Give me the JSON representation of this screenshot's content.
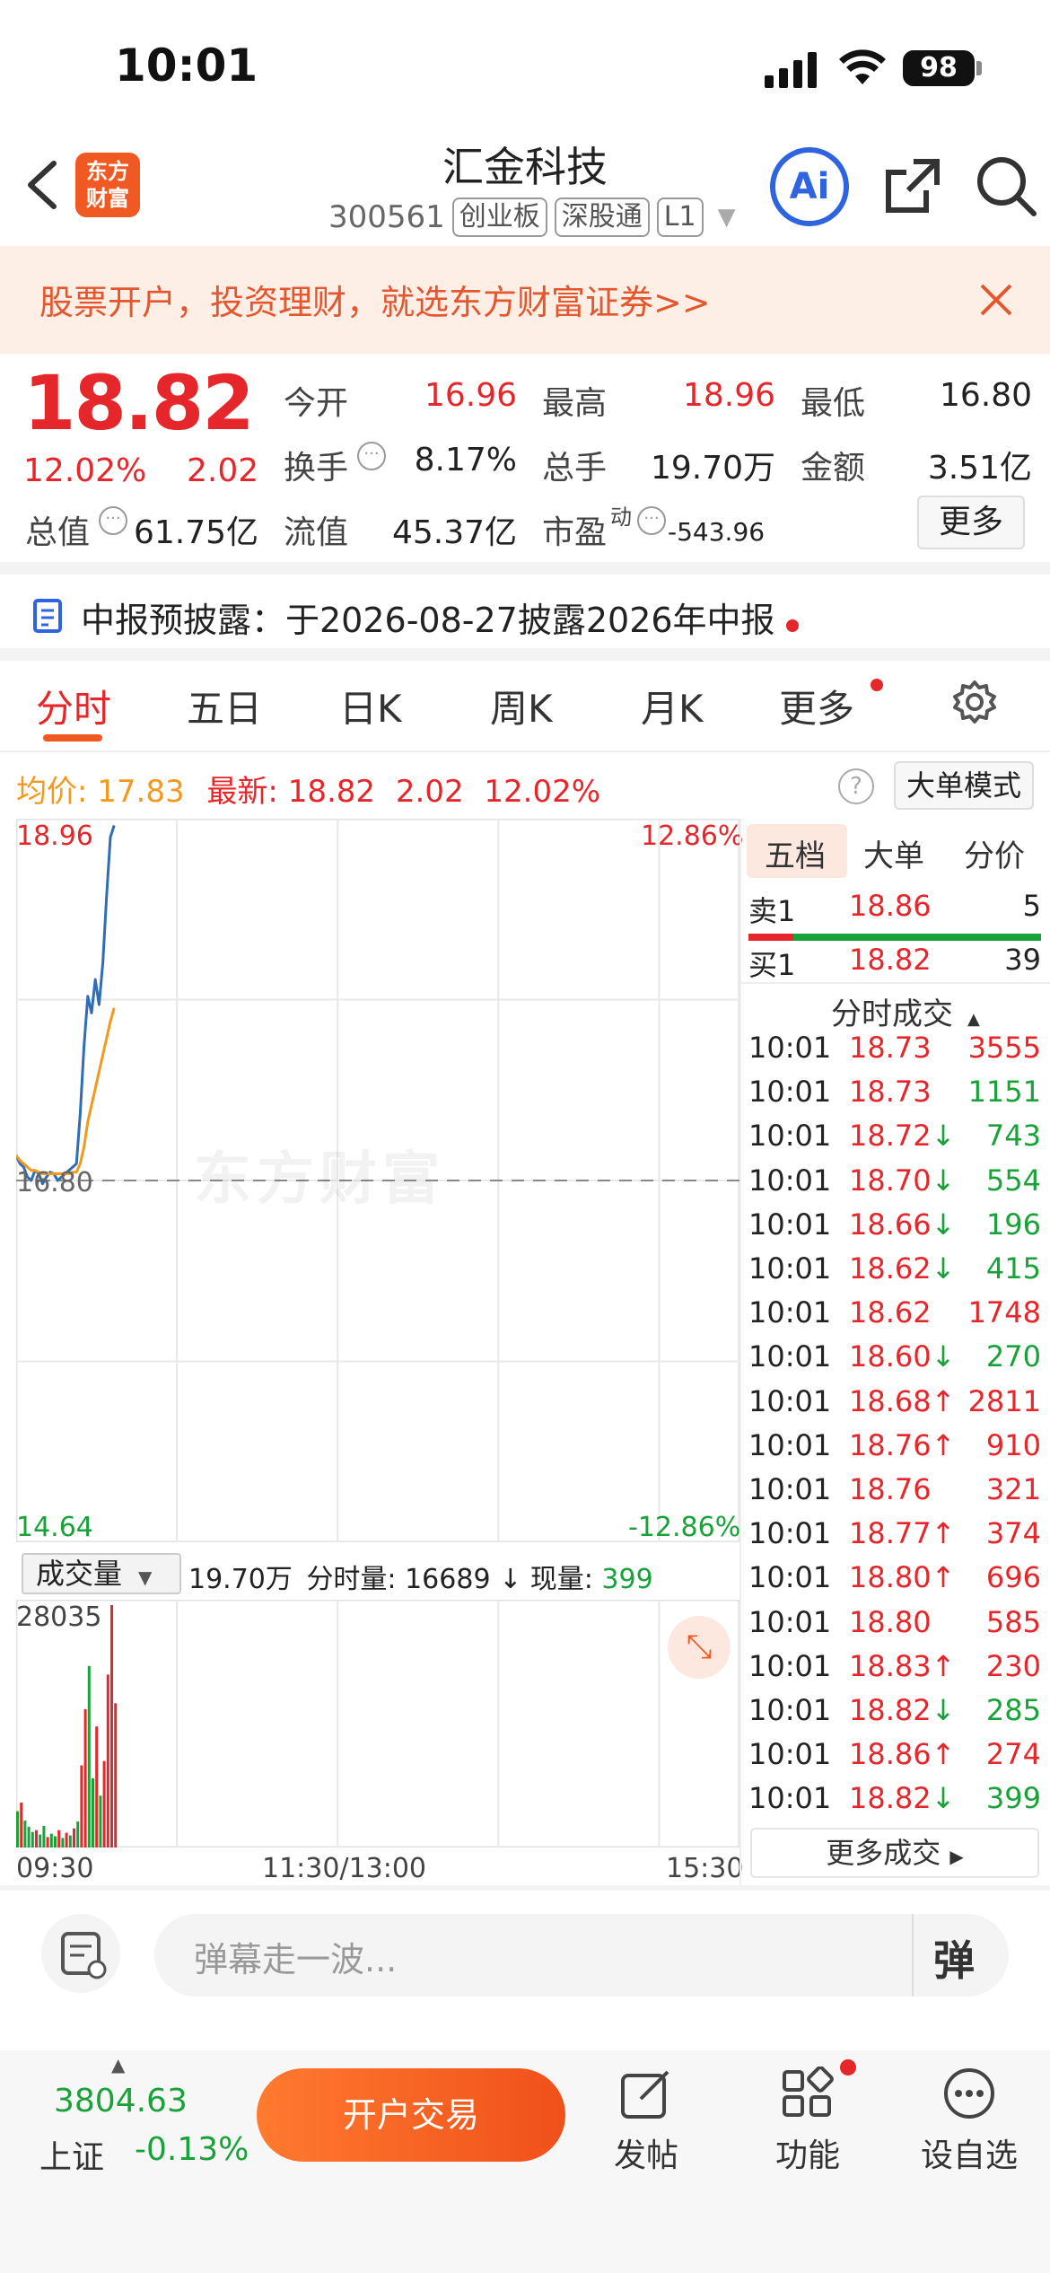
{
  "status_bar": {
    "time": "10:01",
    "battery": "98"
  },
  "header": {
    "title": "汇金科技",
    "code": "300561",
    "tags": [
      "创业板",
      "深股通",
      "L1"
    ],
    "logo_text": "东方财富",
    "ai_label": "Ai"
  },
  "banner": {
    "text": "股票开户，投资理财，就选东方财富证券>>"
  },
  "quote": {
    "price": "18.82",
    "change_pct": "12.02%",
    "change": "2.02",
    "fields": [
      {
        "label": "今开",
        "value": "16.96",
        "color": "#e5262b"
      },
      {
        "label": "最高",
        "value": "18.96",
        "color": "#e5262b"
      },
      {
        "label": "最低",
        "value": "16.80",
        "color": "#222222"
      },
      {
        "label": "换手",
        "value": "8.17%",
        "color": "#222222"
      },
      {
        "label": "总手",
        "value": "19.70万",
        "color": "#222222"
      },
      {
        "label": "金额",
        "value": "3.51亿",
        "color": "#222222"
      },
      {
        "label": "总值",
        "value": "61.75亿",
        "color": "#222222"
      },
      {
        "label": "流值",
        "value": "45.37亿",
        "color": "#222222"
      },
      {
        "label": "市盈",
        "value": "-543.96",
        "color": "#222222",
        "sup": "动"
      }
    ],
    "more_label": "更多"
  },
  "report": {
    "text": "中报预披露：于2026-08-27披露2026年中报"
  },
  "tabs": [
    "分时",
    "五日",
    "日K",
    "周K",
    "月K",
    "更多"
  ],
  "active_tab": "分时",
  "info_line": {
    "avg_label": "均价:",
    "avg_value": "17.83",
    "latest_label": "最新:",
    "latest_value": "18.82",
    "change": "2.02",
    "change_pct": "12.02%",
    "mode_button": "大单模式"
  },
  "chart_data": {
    "type": "line",
    "y_max_label": "18.96",
    "y_min_label": "14.64",
    "y_pct_max": "12.86%",
    "y_pct_min": "-12.86%",
    "prev_close_label": "16.80",
    "prev_close": 16.8,
    "ylim": [
      14.64,
      18.96
    ],
    "x_labels": [
      "09:30",
      "11:30/13:00",
      "15:30"
    ],
    "watermark": "东方财富",
    "series": [
      {
        "name": "最新",
        "color": "#2f6db5",
        "values": [
          16.95,
          16.9,
          16.88,
          16.82,
          16.8,
          16.86,
          16.84,
          16.78,
          16.82,
          16.85,
          16.84,
          16.8,
          16.82,
          16.84,
          16.86,
          16.88,
          16.9,
          17.2,
          17.6,
          17.9,
          17.8,
          18.0,
          17.85,
          18.1,
          18.5,
          18.85,
          18.92
        ]
      },
      {
        "name": "均价",
        "color": "#f29a1d",
        "values": [
          16.95,
          16.92,
          16.9,
          16.88,
          16.86,
          16.86,
          16.85,
          16.84,
          16.84,
          16.84,
          16.84,
          16.84,
          16.84,
          16.84,
          16.84,
          16.85,
          16.85,
          16.9,
          17.0,
          17.15,
          17.25,
          17.35,
          17.45,
          17.55,
          17.65,
          17.75,
          17.83
        ]
      }
    ],
    "volume": {
      "max_label": "28035",
      "total": "19.70万",
      "minute_label": "分时量:",
      "minute_value": "16689",
      "current_label": "现量:",
      "current_value": "399",
      "select_label": "成交量",
      "bars": [
        {
          "v": 4200,
          "c": "#1aa23a"
        },
        {
          "v": 5200,
          "c": "#e5262b"
        },
        {
          "v": 3100,
          "c": "#1aa23a"
        },
        {
          "v": 2400,
          "c": "#1aa23a"
        },
        {
          "v": 1800,
          "c": "#1aa23a"
        },
        {
          "v": 2000,
          "c": "#e5262b"
        },
        {
          "v": 1500,
          "c": "#1aa23a"
        },
        {
          "v": 2500,
          "c": "#1aa23a"
        },
        {
          "v": 1200,
          "c": "#e5262b"
        },
        {
          "v": 1600,
          "c": "#1aa23a"
        },
        {
          "v": 1300,
          "c": "#1aa23a"
        },
        {
          "v": 2000,
          "c": "#e5262b"
        },
        {
          "v": 1100,
          "c": "#1aa23a"
        },
        {
          "v": 1700,
          "c": "#e5262b"
        },
        {
          "v": 1400,
          "c": "#1aa23a"
        },
        {
          "v": 2200,
          "c": "#e5262b"
        },
        {
          "v": 3000,
          "c": "#1aa23a"
        },
        {
          "v": 9500,
          "c": "#e5262b"
        },
        {
          "v": 16000,
          "c": "#e5262b"
        },
        {
          "v": 21000,
          "c": "#1aa23a"
        },
        {
          "v": 8000,
          "c": "#1aa23a"
        },
        {
          "v": 14000,
          "c": "#e5262b"
        },
        {
          "v": 6000,
          "c": "#1aa23a"
        },
        {
          "v": 10000,
          "c": "#e5262b"
        },
        {
          "v": 20000,
          "c": "#e5262b"
        },
        {
          "v": 28035,
          "c": "#e5262b"
        },
        {
          "v": 16689,
          "c": "#e5262b"
        }
      ]
    }
  },
  "panel": {
    "tabs": [
      "五档",
      "大单",
      "分价"
    ],
    "sell1": {
      "label": "卖1",
      "price": "18.86",
      "vol": "5"
    },
    "buy1": {
      "label": "买1",
      "price": "18.82",
      "vol": "39"
    },
    "trades_header": "分时成交",
    "trades": [
      {
        "t": "10:01",
        "p": "18.73",
        "a": "",
        "v": "3555",
        "pc": "#e5262b",
        "vc": "#e5262b"
      },
      {
        "t": "10:01",
        "p": "18.73",
        "a": "",
        "v": "1151",
        "pc": "#e5262b",
        "vc": "#1aa23a"
      },
      {
        "t": "10:01",
        "p": "18.72",
        "a": "↓",
        "v": "743",
        "pc": "#e5262b",
        "vc": "#1aa23a"
      },
      {
        "t": "10:01",
        "p": "18.70",
        "a": "↓",
        "v": "554",
        "pc": "#e5262b",
        "vc": "#1aa23a"
      },
      {
        "t": "10:01",
        "p": "18.66",
        "a": "↓",
        "v": "196",
        "pc": "#e5262b",
        "vc": "#1aa23a"
      },
      {
        "t": "10:01",
        "p": "18.62",
        "a": "↓",
        "v": "415",
        "pc": "#e5262b",
        "vc": "#1aa23a"
      },
      {
        "t": "10:01",
        "p": "18.62",
        "a": "",
        "v": "1748",
        "pc": "#e5262b",
        "vc": "#e5262b"
      },
      {
        "t": "10:01",
        "p": "18.60",
        "a": "↓",
        "v": "270",
        "pc": "#e5262b",
        "vc": "#1aa23a"
      },
      {
        "t": "10:01",
        "p": "18.68",
        "a": "↑",
        "v": "2811",
        "pc": "#e5262b",
        "vc": "#e5262b"
      },
      {
        "t": "10:01",
        "p": "18.76",
        "a": "↑",
        "v": "910",
        "pc": "#e5262b",
        "vc": "#e5262b"
      },
      {
        "t": "10:01",
        "p": "18.76",
        "a": "",
        "v": "321",
        "pc": "#e5262b",
        "vc": "#e5262b"
      },
      {
        "t": "10:01",
        "p": "18.77",
        "a": "↑",
        "v": "374",
        "pc": "#e5262b",
        "vc": "#e5262b"
      },
      {
        "t": "10:01",
        "p": "18.80",
        "a": "↑",
        "v": "696",
        "pc": "#e5262b",
        "vc": "#e5262b"
      },
      {
        "t": "10:01",
        "p": "18.80",
        "a": "",
        "v": "585",
        "pc": "#e5262b",
        "vc": "#e5262b"
      },
      {
        "t": "10:01",
        "p": "18.83",
        "a": "↑",
        "v": "230",
        "pc": "#e5262b",
        "vc": "#e5262b"
      },
      {
        "t": "10:01",
        "p": "18.82",
        "a": "↓",
        "v": "285",
        "pc": "#e5262b",
        "vc": "#1aa23a"
      },
      {
        "t": "10:01",
        "p": "18.86",
        "a": "↑",
        "v": "274",
        "pc": "#e5262b",
        "vc": "#e5262b"
      },
      {
        "t": "10:01",
        "p": "18.82",
        "a": "↓",
        "v": "399",
        "pc": "#e5262b",
        "vc": "#1aa23a"
      }
    ],
    "more_trades": "更多成交"
  },
  "comment": {
    "placeholder": "弹幕走一波...",
    "danmu_label": "弹"
  },
  "bottom": {
    "index_value": "3804.63",
    "index_name": "上证",
    "index_change": "-0.13%",
    "open_button": "开户交易",
    "items": [
      {
        "label": "发帖",
        "icon": "edit-icon"
      },
      {
        "label": "功能",
        "icon": "grid-icon"
      },
      {
        "label": "设自选",
        "icon": "more-icon"
      }
    ]
  },
  "colors": {
    "red": "#e5262b",
    "green": "#1aa23a",
    "orange": "#f05a22",
    "blue_line": "#2f6db5",
    "avg_line": "#f29a1d"
  }
}
